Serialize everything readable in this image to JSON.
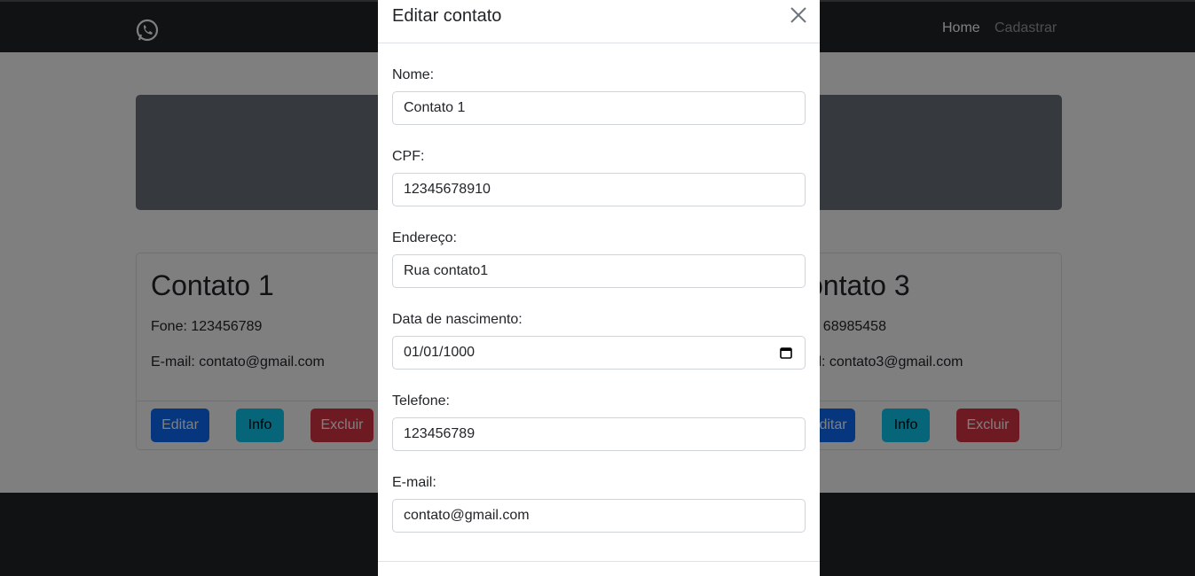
{
  "navbar": {
    "brand_icon": "whatsapp-icon",
    "links": [
      "Home",
      "Cadastrar"
    ]
  },
  "cards": [
    {
      "title": "Contato 1",
      "phone": "Fone: 123456789",
      "email": "E-mail: contato@gmail.com",
      "buttons": [
        "Editar",
        "Info",
        "Excluir"
      ]
    },
    {
      "title": "ontato 3",
      "phone": "e: 68985458",
      "email": "ail: contato3@gmail.com",
      "buttons": [
        "ditar",
        "Info",
        "Excluir"
      ]
    }
  ],
  "modal": {
    "title": "Editar contato",
    "fields": [
      {
        "label": "Nome:",
        "value": "Contato 1"
      },
      {
        "label": "CPF:",
        "value": "12345678910"
      },
      {
        "label": "Endereço:",
        "value": "Rua contato1"
      },
      {
        "label": "Data de nascimento:",
        "value": "01/01/1000"
      },
      {
        "label": "Telefone:",
        "value": "123456789"
      },
      {
        "label": "E-mail:",
        "value": "contato@gmail.com"
      }
    ]
  },
  "colors": {
    "primary": "#0d6efd",
    "info": "#0dcaf0",
    "danger": "#dc3545",
    "dark": "#212529"
  }
}
